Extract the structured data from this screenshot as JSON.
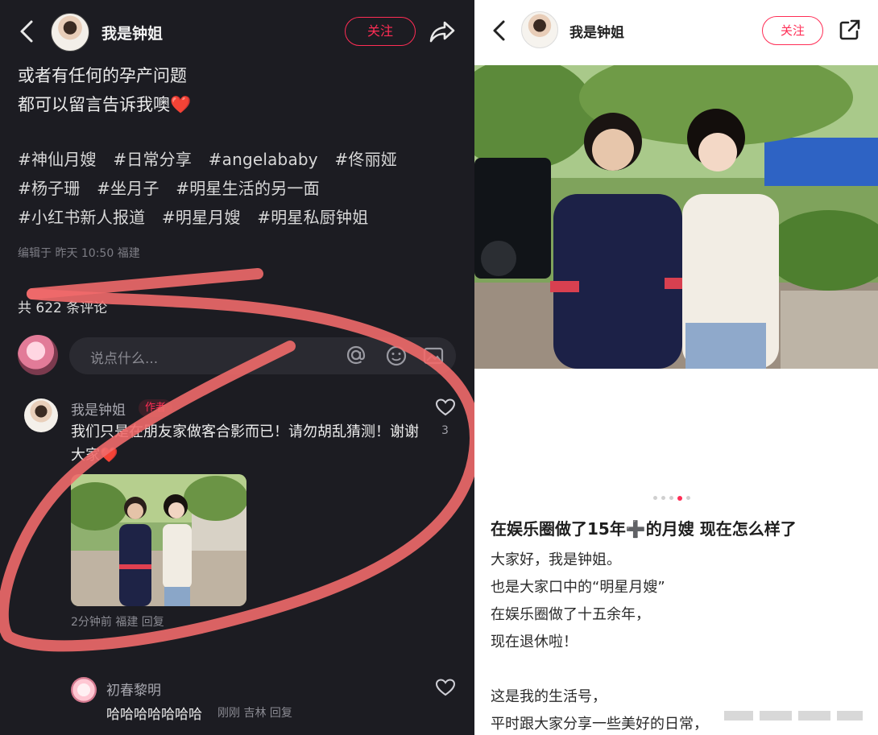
{
  "left": {
    "author": "我是钟姐",
    "follow_label": "关注",
    "body_lines": [
      "或者有任何的孕产问题",
      "都可以留言告诉我噢❤️"
    ],
    "tags": [
      "#神仙月嫂",
      "#日常分享",
      "#angelababy",
      "#佟丽娅",
      "#杨子珊",
      "#坐月子",
      "#明星生活的另一面",
      "#小红书新人报道",
      "#明星月嫂",
      "#明星私厨钟姐"
    ],
    "edited": "编辑于 昨天 10:50 福建",
    "comment_count": "共 622 条评论",
    "input_placeholder": "说点什么...",
    "comments": [
      {
        "name": "我是钟姐",
        "badge": "作者",
        "text": "我们只是在朋友家做客合影而已！请勿胡乱猜测！谢谢大家❤️",
        "likes": "3",
        "meta": "2分钟前 福建 回复"
      },
      {
        "name": "初春黎明",
        "text": "哈哈哈哈哈哈哈",
        "meta": "刚刚 吉林 回复"
      }
    ],
    "annotation_color": "#f06a6a"
  },
  "right": {
    "author": "我是钟姐",
    "follow_label": "关注",
    "carousel": {
      "count": 5,
      "active_index": 3
    },
    "title": "在娱乐圈做了15年➕的月嫂 现在怎么样了",
    "paragraphs": [
      "大家好，我是钟姐。",
      "也是大家口中的“明星月嫂”",
      "在娱乐圈做了十五余年，",
      "现在退休啦！",
      "",
      "这是我的生活号，",
      "平时跟大家分享一些美好的日常，"
    ]
  },
  "colors": {
    "accent": "#ff2d55",
    "dark_bg": "#1c1c22"
  },
  "icons": [
    "back-arrow-icon",
    "share-icon",
    "at-icon",
    "emoji-icon",
    "image-icon",
    "heart-icon",
    "external-share-icon"
  ]
}
